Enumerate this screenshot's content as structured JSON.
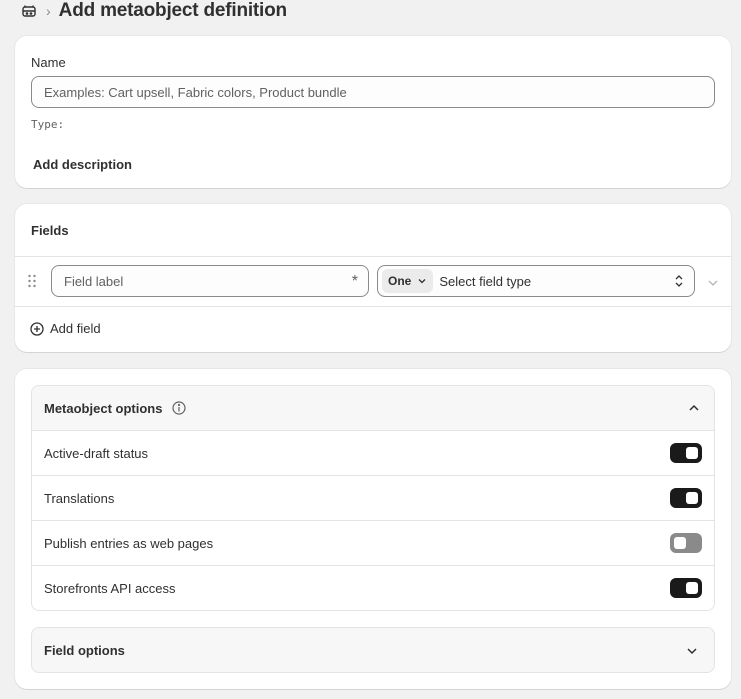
{
  "header": {
    "title": "Add metaobject definition",
    "separator": "›"
  },
  "name_card": {
    "name_label": "Name",
    "name_placeholder": "Examples: Cart upsell, Fabric colors, Product bundle",
    "type_label": "Type:",
    "add_description": "Add description"
  },
  "fields_card": {
    "title": "Fields",
    "field_label_placeholder": "Field label",
    "required_marker": "*",
    "cardinality": "One",
    "field_type_placeholder": "Select field type",
    "add_field": "Add field"
  },
  "options_card": {
    "metaobject_options_title": "Metaobject options",
    "options": [
      {
        "label": "Active-draft status",
        "enabled": true
      },
      {
        "label": "Translations",
        "enabled": true
      },
      {
        "label": "Publish entries as web pages",
        "enabled": false
      },
      {
        "label": "Storefronts API access",
        "enabled": true
      }
    ],
    "field_options_title": "Field options"
  },
  "icons": {
    "back": "metaobject-icon",
    "drag": "drag-handle-icon",
    "add": "plus-circle-icon",
    "info": "info-icon",
    "chevron_up": "chevron-up-icon",
    "chevron_down": "chevron-down-icon",
    "select": "select-arrows-icon"
  }
}
